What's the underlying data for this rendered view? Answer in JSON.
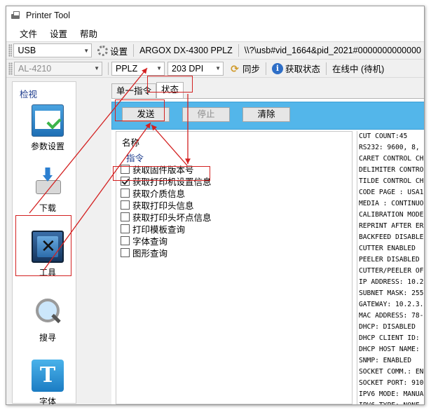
{
  "window": {
    "title": "Printer Tool"
  },
  "menu": {
    "items": [
      "文件",
      "设置",
      "帮助"
    ]
  },
  "toolbar1": {
    "port": "USB",
    "settings_label": "设置",
    "printer_name": "ARGOX DX-4300 PPLZ",
    "device_path": "\\\\?\\usb#vid_1664&pid_2021#0000000000000"
  },
  "toolbar2": {
    "model": "AL-4210",
    "language": "PPLZ",
    "dpi": "203 DPI",
    "sync_label": "同步",
    "get_status_label": "获取状态",
    "online_status": "在线中 (待机)"
  },
  "sidebar": {
    "title": "检视",
    "items": [
      {
        "label": "参数设置",
        "icon": "params-icon"
      },
      {
        "label": "下载",
        "icon": "download-icon"
      },
      {
        "label": "工具",
        "icon": "tools-icon"
      },
      {
        "label": "搜寻",
        "icon": "search-icon"
      },
      {
        "label": "字体",
        "icon": "font-icon"
      }
    ]
  },
  "tabs": [
    "单一指令",
    "状态"
  ],
  "actions": {
    "send": "发送",
    "stop": "停止",
    "clear": "清除"
  },
  "command_list": {
    "column_header": "名称",
    "group": "指令",
    "items": [
      {
        "label": "获取固件版本号",
        "checked": false
      },
      {
        "label": "获取打印机设置信息",
        "checked": true
      },
      {
        "label": "获取介质信息",
        "checked": false
      },
      {
        "label": "获取打印头信息",
        "checked": false
      },
      {
        "label": "获取打印头坏点信息",
        "checked": false
      },
      {
        "label": "打印模板查询",
        "checked": false
      },
      {
        "label": "字体查询",
        "checked": false
      },
      {
        "label": "图形查询",
        "checked": false
      }
    ]
  },
  "output_lines": [
    "CUT COUNT:45",
    "RS232: 9600, 8,",
    "CARET CONTROL CH",
    "DELIMITER CONTRO",
    "TILDE CONTROL CH",
    "CODE PAGE : USA1",
    "MEDIA : CONTINUO",
    "CALIBRATION MODE",
    "REPRINT AFTER ER",
    "BACKFEED DISABLE",
    "CUTTER ENABLED",
    "PEELER DISABLED",
    "CUTTER/PEELER OF",
    "IP ADDRESS: 10.2",
    "SUBNET MASK: 255",
    "GATEWAY: 10.2.3.",
    "MAC ADDRESS: 78-",
    "DHCP: DISABLED",
    "DHCP CLIENT ID:",
    "DHCP HOST NAME:",
    "SNMP: ENABLED",
    "SOCKET COMM.: EN",
    "SOCKET PORT: 910",
    "IPV6 MODE: MANUA",
    "IPV6 TYPE: NONE"
  ],
  "colors": {
    "action_bar": "#53b6ea",
    "highlight": "#d32121",
    "sidebar_title": "#1b3a8c"
  }
}
